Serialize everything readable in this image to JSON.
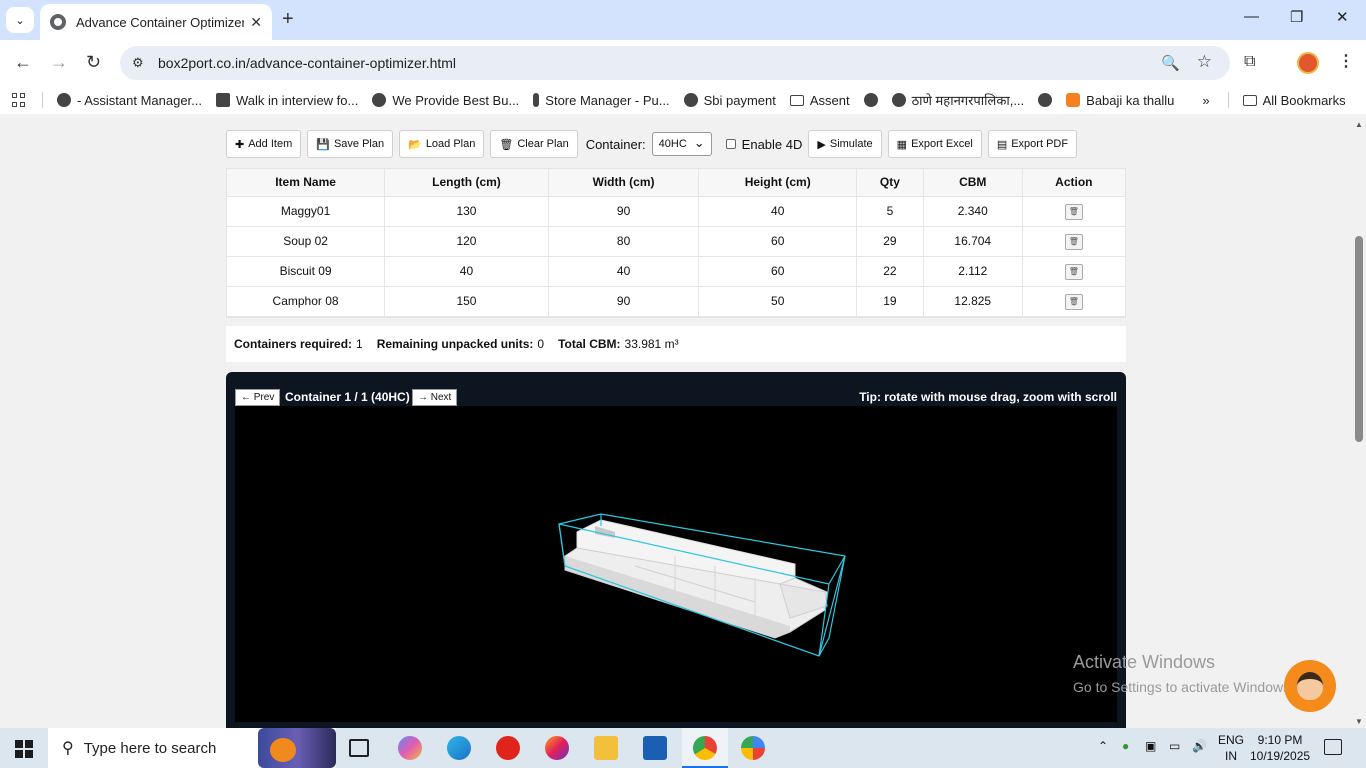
{
  "browser": {
    "tab_title": "Advance Container Optimizer |",
    "url": "box2port.co.in/advance-container-optimizer.html",
    "bookmarks": [
      "- Assistant Manager...",
      "Walk in interview fo...",
      "We Provide Best Bu...",
      "Store Manager - Pu...",
      "Sbi payment",
      "Assent",
      "",
      "ठाणे महानगरपालिका,...",
      "",
      "Babaji ka thallu"
    ],
    "more_bookmarks": "»",
    "all_bookmarks": "All Bookmarks"
  },
  "controls": {
    "add_item": "Add Item",
    "save_plan": "Save Plan",
    "load_plan": "Load Plan",
    "clear_plan": "Clear Plan",
    "container_label": "Container:",
    "container_value": "40HC",
    "enable_4d": "Enable 4D",
    "simulate": "Simulate",
    "export_excel": "Export Excel",
    "export_pdf": "Export PDF"
  },
  "table": {
    "headers": [
      "Item Name",
      "Length (cm)",
      "Width (cm)",
      "Height (cm)",
      "Qty",
      "CBM",
      "Action"
    ],
    "rows": [
      [
        "Maggy01",
        "130",
        "90",
        "40",
        "5",
        "2.340"
      ],
      [
        "Soup 02",
        "120",
        "80",
        "60",
        "29",
        "16.704"
      ],
      [
        "Biscuit 09",
        "40",
        "40",
        "60",
        "22",
        "2.112"
      ],
      [
        "Camphor 08",
        "150",
        "90",
        "50",
        "19",
        "12.825"
      ]
    ],
    "delete_icon": "🗑"
  },
  "summary": {
    "containers_label": "Containers required:",
    "containers_value": "1",
    "remaining_label": "Remaining unpacked units:",
    "remaining_value": "0",
    "cbm_label": "Total CBM:",
    "cbm_value": "33.981 m³"
  },
  "viewer": {
    "prev": "← Prev",
    "container_label": "Container 1 / 1 (40HC)",
    "next": "→ Next",
    "tip": "Tip: rotate with mouse drag, zoom with scroll"
  },
  "watermark": {
    "line1": "Activate Windows",
    "line2": "Go to Settings to activate Windows."
  },
  "taskbar": {
    "search_placeholder": "Type here to search",
    "lang_top": "ENG",
    "lang_bottom": "IN",
    "time": "9:10 PM",
    "date": "10/19/2025"
  },
  "colors": {
    "container_outline": "#2ec6e0",
    "viewer_bg": "#0d1520",
    "canvas_bg": "#000000",
    "tabbar_bg": "#d3e3fd"
  }
}
